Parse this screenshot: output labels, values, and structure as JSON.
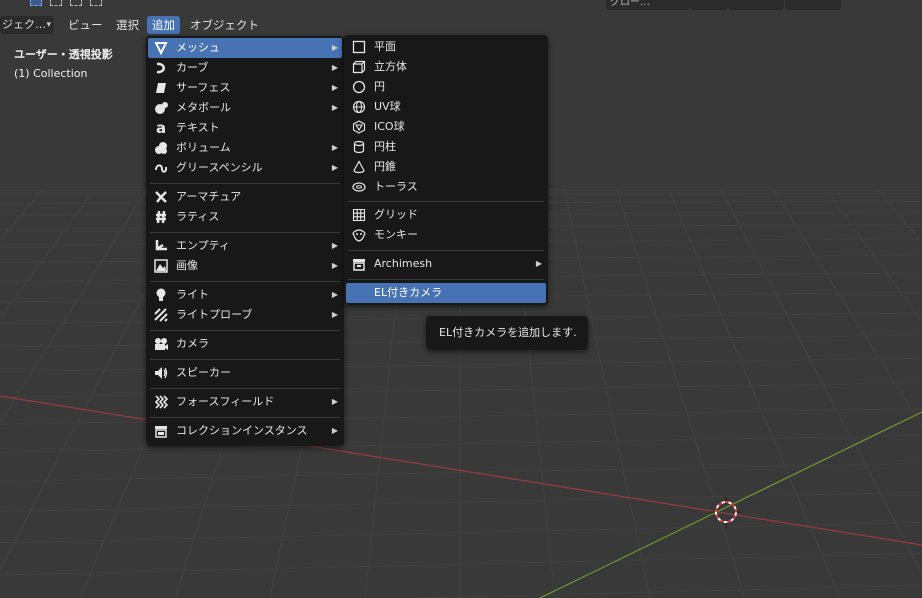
{
  "colors": {
    "viewport_bg": "#393939",
    "grid_line": "#414141",
    "x_axis": "#9b3a3f",
    "y_axis": "#6f9a2e",
    "menu_bg": "#181818",
    "highlight": "#4772b3"
  },
  "header": {
    "mode_select": "ジェク…",
    "menus": [
      {
        "label": "ビュー",
        "active": false
      },
      {
        "label": "選択",
        "active": false
      },
      {
        "label": "追加",
        "active": true
      },
      {
        "label": "オブジェクト",
        "active": false
      }
    ],
    "right_tools": [
      "グロー…",
      "",
      "",
      ""
    ]
  },
  "viewport": {
    "view_label": "ユーザー・透視投影",
    "collection_label": "(1) Collection"
  },
  "add_menu": {
    "items": [
      {
        "label": "メッシュ",
        "icon": "mesh-icon",
        "submenu": true,
        "highlighted": true
      },
      {
        "label": "カーブ",
        "icon": "curve-icon",
        "submenu": true
      },
      {
        "label": "サーフェス",
        "icon": "surface-icon",
        "submenu": true
      },
      {
        "label": "メタボール",
        "icon": "metaball-icon",
        "submenu": true
      },
      {
        "label": "テキスト",
        "icon": "text-icon",
        "submenu": false
      },
      {
        "label": "ボリューム",
        "icon": "volume-icon",
        "submenu": true
      },
      {
        "label": "グリースペンシル",
        "icon": "grease-pencil-icon",
        "submenu": true
      },
      {
        "label": "アーマチュア",
        "icon": "armature-icon",
        "submenu": false
      },
      {
        "label": "ラティス",
        "icon": "lattice-icon",
        "submenu": false
      },
      {
        "label": "エンプティ",
        "icon": "empty-icon",
        "submenu": true
      },
      {
        "label": "画像",
        "icon": "image-icon",
        "submenu": true
      },
      {
        "label": "ライト",
        "icon": "light-icon",
        "submenu": true
      },
      {
        "label": "ライトプローブ",
        "icon": "light-probe-icon",
        "submenu": true
      },
      {
        "label": "カメラ",
        "icon": "camera-icon",
        "submenu": false
      },
      {
        "label": "スピーカー",
        "icon": "speaker-icon",
        "submenu": false
      },
      {
        "label": "フォースフィールド",
        "icon": "force-field-icon",
        "submenu": true
      },
      {
        "label": "コレクションインスタンス",
        "icon": "collection-instance-icon",
        "submenu": true
      }
    ]
  },
  "mesh_menu": {
    "items": [
      {
        "label": "平面",
        "icon": "plane-icon"
      },
      {
        "label": "立方体",
        "icon": "cube-icon"
      },
      {
        "label": "円",
        "icon": "circle-icon"
      },
      {
        "label": "UV球",
        "icon": "uv-sphere-icon"
      },
      {
        "label": "ICO球",
        "icon": "ico-sphere-icon"
      },
      {
        "label": "円柱",
        "icon": "cylinder-icon"
      },
      {
        "label": "円錐",
        "icon": "cone-icon"
      },
      {
        "label": "トーラス",
        "icon": "torus-icon"
      },
      {
        "label": "グリッド",
        "icon": "grid-icon"
      },
      {
        "label": "モンキー",
        "icon": "monkey-icon"
      },
      {
        "label": "Archimesh",
        "icon": "archimesh-icon",
        "submenu": true
      },
      {
        "label": "EL付きカメラ",
        "icon": "",
        "highlighted": true
      }
    ]
  },
  "tooltip": {
    "text": "EL付きカメラを追加します."
  }
}
